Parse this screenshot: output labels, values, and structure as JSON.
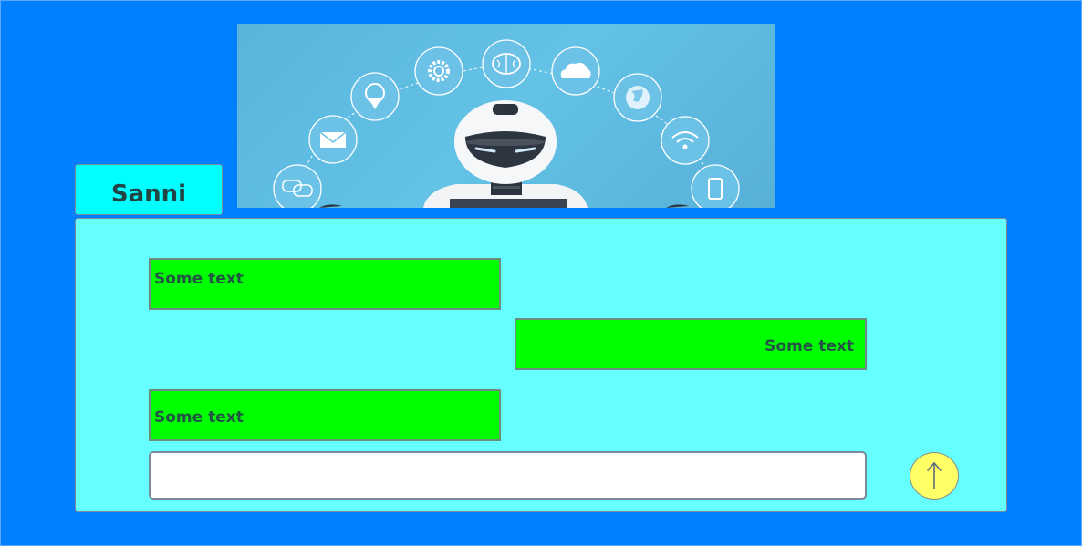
{
  "header": {
    "name": "Sanni"
  },
  "banner": {
    "icons": [
      "chat-bubbles-icon",
      "envelope-icon",
      "location-pin-icon",
      "gear-icon",
      "brain-icon",
      "cloud-icon",
      "globe-icon",
      "wifi-icon",
      "smartphone-icon"
    ],
    "robot": "robot-illustration"
  },
  "chat": {
    "messages": [
      {
        "text": "Some text",
        "align": "left"
      },
      {
        "text": "Some text",
        "align": "right"
      },
      {
        "text": "Some text",
        "align": "left"
      }
    ],
    "input": {
      "value": "",
      "placeholder": ""
    },
    "send_icon": "up-arrow-icon"
  },
  "colors": {
    "background": "#0080ff",
    "tab": "#00ffff",
    "panel": "#66ffff",
    "message": "#00ff00",
    "send_button": "#ffff66"
  }
}
